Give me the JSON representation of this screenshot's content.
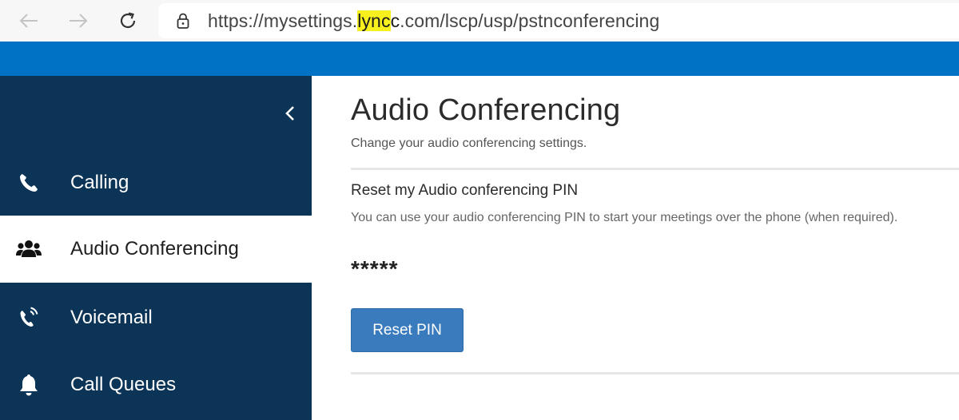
{
  "browser": {
    "url_prefix": "https://mysettings.",
    "url_highlight": "lync",
    "url_domain_rest": "c",
    "url_suffix": ".com/lscp/usp/pstnconferencing",
    "highlight_color": "#f7f01e"
  },
  "sidebar": {
    "collapse_icon": "chevron-left-icon",
    "items": [
      {
        "label": "Calling",
        "icon": "phone-icon",
        "active": false
      },
      {
        "label": "Audio Conferencing",
        "icon": "users-group-icon",
        "active": true
      },
      {
        "label": "Voicemail",
        "icon": "phone-ringing-icon",
        "active": false
      },
      {
        "label": "Call Queues",
        "icon": "bell-icon",
        "active": false
      }
    ]
  },
  "main": {
    "title": "Audio Conferencing",
    "subtitle": "Change your audio conferencing settings.",
    "section": {
      "title": "Reset my Audio conferencing PIN",
      "description": "You can use your audio conferencing PIN to start your meetings over the phone (when required).",
      "pin_masked": "*****",
      "reset_button_label": "Reset PIN"
    }
  },
  "colors": {
    "brand_blue": "#0072c6",
    "sidebar_bg": "#0c3457",
    "button_bg": "#3a7bbd"
  }
}
